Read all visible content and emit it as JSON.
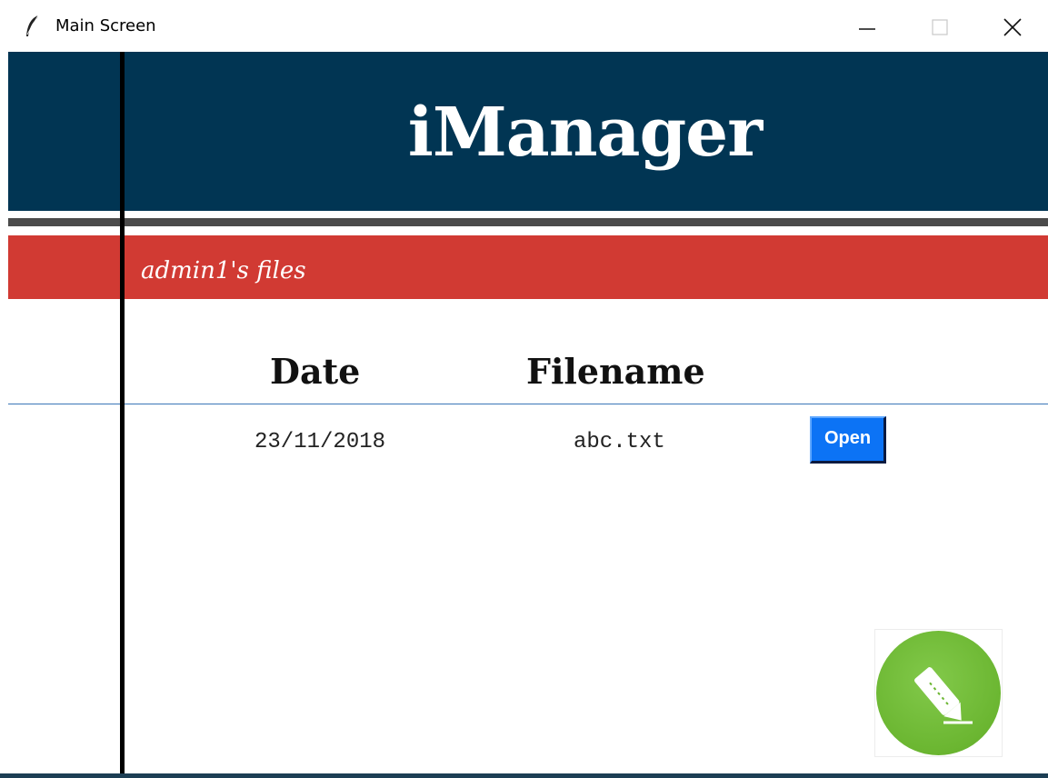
{
  "window": {
    "title": "Main Screen",
    "icon": "feather-icon",
    "controls": [
      "minimize-icon",
      "maximize-icon",
      "close-icon"
    ]
  },
  "header": {
    "app_name": "iManager",
    "background_color": "#013553"
  },
  "section": {
    "title": "admin1's files",
    "background_color": "#d13a33"
  },
  "table": {
    "columns": [
      "Date",
      "Filename"
    ],
    "rows": [
      {
        "date": "23/11/2018",
        "filename": "abc.txt",
        "action": "Open"
      }
    ]
  },
  "fab": {
    "icon": "pencil-icon",
    "color": "#6bb631"
  },
  "colors": {
    "open_button": "#0c73f5",
    "divider": "#3a76b8"
  }
}
